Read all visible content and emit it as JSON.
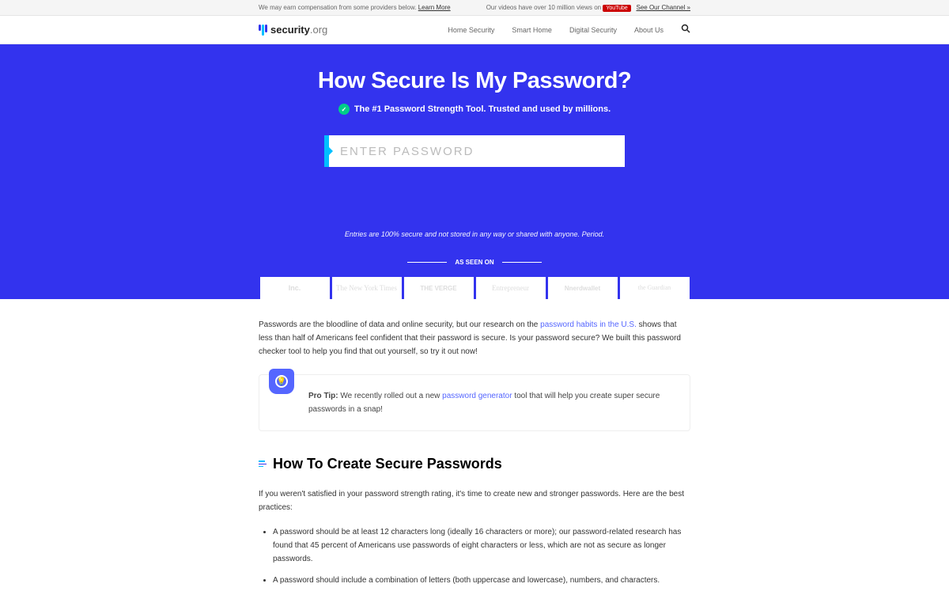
{
  "topbar": {
    "left_text": "We may earn compensation from some providers below. ",
    "learn_more": "Learn More",
    "right_text": "Our videos have over 10 million views on ",
    "youtube": "YouTube",
    "channel": "See Our Channel »"
  },
  "header": {
    "brand_bold": "security",
    "brand_thin": ".org",
    "nav": [
      "Home Security",
      "Smart Home",
      "Digital Security",
      "About Us"
    ]
  },
  "hero": {
    "title": "How Secure Is My Password?",
    "subtitle": "The #1 Password Strength Tool. Trusted and used by millions.",
    "placeholder": "ENTER PASSWORD",
    "note": "Entries are 100% secure and not stored in any way or shared with anyone. Period.",
    "seen_label": "AS SEEN ON",
    "press": [
      "Inc.",
      "The New York Times",
      "THE VERGE",
      "Entrepreneur",
      "nerdwallet",
      "the Guardian"
    ]
  },
  "content": {
    "intro_a": "Passwords are the bloodline of data and online security, but our research on the ",
    "intro_link1": "password habits in the U.S.",
    "intro_b": " shows that less than half of Americans feel confident that their password is secure. Is your password secure? We built this password checker tool to help you find that out yourself, so try it out now!",
    "tip_label": "Pro Tip:",
    "tip_a": " We recently rolled out a new ",
    "tip_link": "password generator",
    "tip_b": " tool that will help you create super secure passwords in a snap!",
    "h2": "How To Create Secure Passwords",
    "sub": "If you weren't satisfied in your password strength rating, it's time to create new and stronger passwords. Here are the best practices:",
    "li1": "A password should be at least 12 characters long (ideally 16 characters or more); our password-related research has found that 45 percent of Americans use passwords of eight characters or less, which are not as secure as longer passwords.",
    "li2": "A password should include a combination of letters (both uppercase and lowercase), numbers, and characters."
  }
}
